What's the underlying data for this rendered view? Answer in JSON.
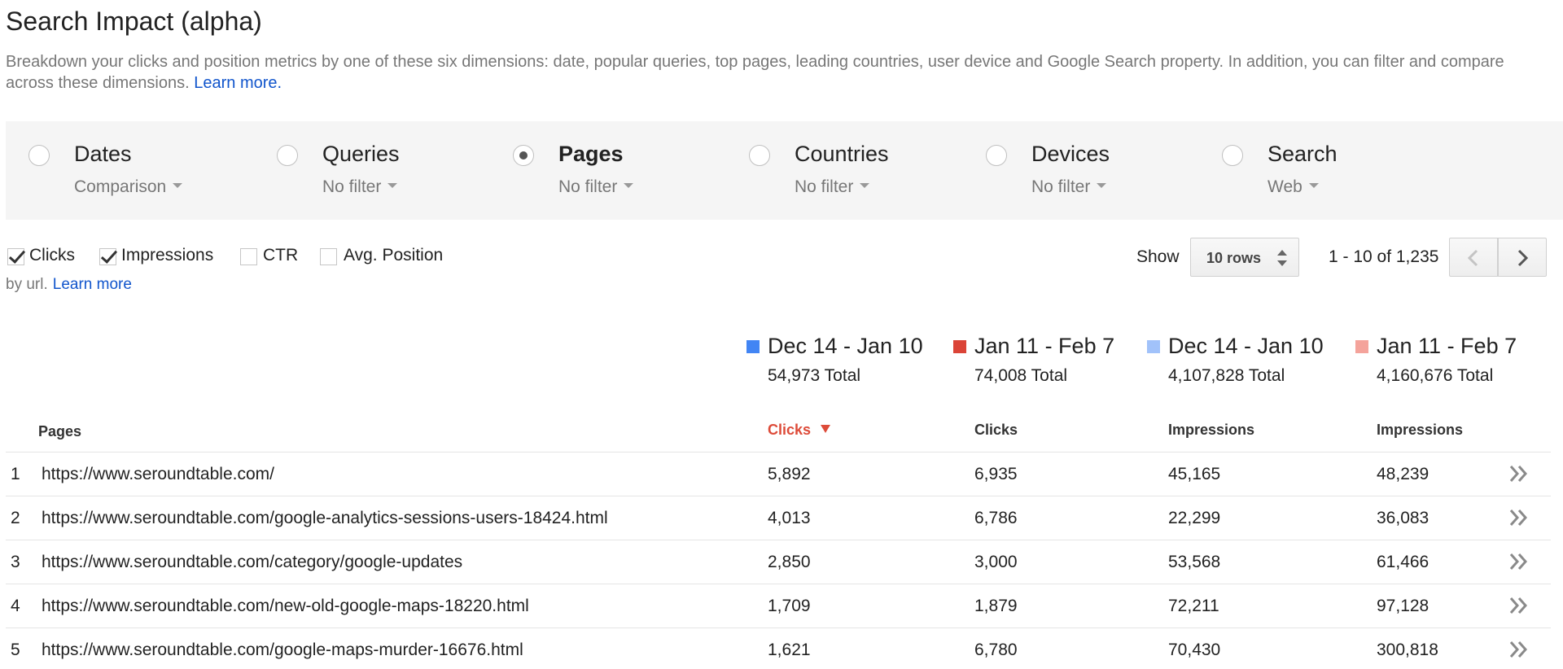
{
  "page": {
    "title": "Search Impact (alpha)",
    "description": "Breakdown your clicks and position metrics by one of these six dimensions: date, popular queries, top pages, leading countries, user device and Google Search property. In addition, you can filter and compare across these dimensions.",
    "learn_more": "Learn more."
  },
  "dimensions": [
    {
      "label": "Dates",
      "filter": "Comparison",
      "selected": false
    },
    {
      "label": "Queries",
      "filter": "No filter",
      "selected": false
    },
    {
      "label": "Pages",
      "filter": "No filter",
      "selected": true
    },
    {
      "label": "Countries",
      "filter": "No filter",
      "selected": false
    },
    {
      "label": "Devices",
      "filter": "No filter",
      "selected": false
    },
    {
      "label": "Search",
      "filter": "Web",
      "selected": false
    }
  ],
  "metrics": [
    {
      "label": "Clicks",
      "checked": true
    },
    {
      "label": "Impressions",
      "checked": true
    },
    {
      "label": "CTR",
      "checked": false
    },
    {
      "label": "Avg. Position",
      "checked": false
    }
  ],
  "note": {
    "text": "by url.",
    "learn_more": "Learn more"
  },
  "pagination": {
    "show_label": "Show",
    "rows_value": "10 rows",
    "range": "1 - 10 of 1,235"
  },
  "legend": [
    {
      "label": "Dec 14 - Jan 10",
      "total": "54,973 Total",
      "color": "#4285f4"
    },
    {
      "label": "Jan 11 - Feb 7",
      "total": "74,008 Total",
      "color": "#db4437"
    },
    {
      "label": "Dec 14 - Jan 10",
      "total": "4,107,828 Total",
      "color": "#a1c2fa"
    },
    {
      "label": "Jan 11 - Feb 7",
      "total": "4,160,676 Total",
      "color": "#f4a39b"
    }
  ],
  "table": {
    "headers": [
      "Pages",
      "Clicks",
      "Clicks",
      "Impressions",
      "Impressions"
    ],
    "rows": [
      {
        "num": "1",
        "page": "https://www.seroundtable.com/",
        "c1": "5,892",
        "c2": "6,935",
        "i1": "45,165",
        "i2": "48,239"
      },
      {
        "num": "2",
        "page": "https://www.seroundtable.com/google-analytics-sessions-users-18424.html",
        "c1": "4,013",
        "c2": "6,786",
        "i1": "22,299",
        "i2": "36,083"
      },
      {
        "num": "3",
        "page": "https://www.seroundtable.com/category/google-updates",
        "c1": "2,850",
        "c2": "3,000",
        "i1": "53,568",
        "i2": "61,466"
      },
      {
        "num": "4",
        "page": "https://www.seroundtable.com/new-old-google-maps-18220.html",
        "c1": "1,709",
        "c2": "1,879",
        "i1": "72,211",
        "i2": "97,128"
      },
      {
        "num": "5",
        "page": "https://www.seroundtable.com/google-maps-murder-16676.html",
        "c1": "1,621",
        "c2": "6,780",
        "i1": "70,430",
        "i2": "300,818"
      }
    ]
  }
}
